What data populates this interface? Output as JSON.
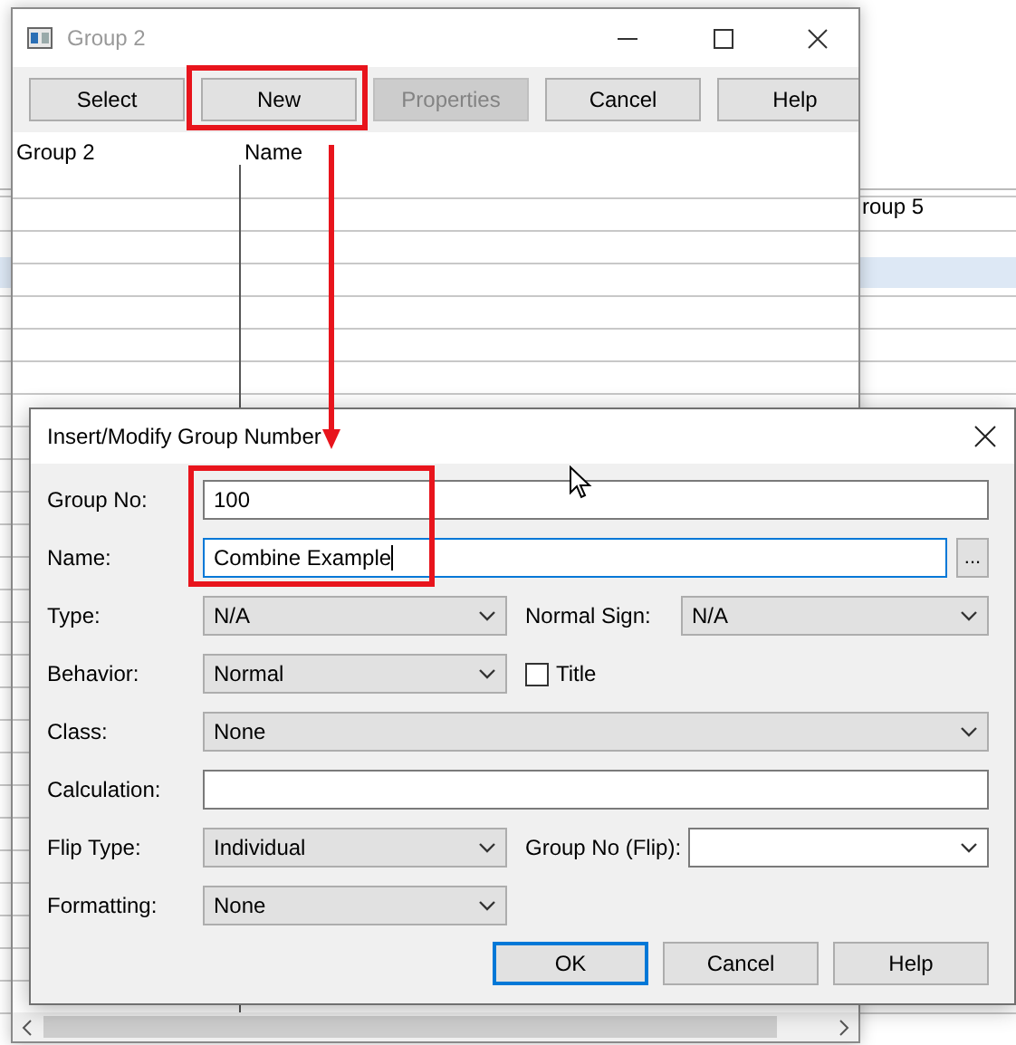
{
  "background": {
    "cell_text": "roup 5"
  },
  "window": {
    "title": "Group 2",
    "buttons": [
      {
        "label": "Select",
        "disabled": false
      },
      {
        "label": "New",
        "disabled": false
      },
      {
        "label": "Properties",
        "disabled": true
      },
      {
        "label": "Cancel",
        "disabled": false
      },
      {
        "label": "Help",
        "disabled": false
      }
    ],
    "table": {
      "columns": [
        "Group 2",
        "Name"
      ]
    }
  },
  "dialog": {
    "title": "Insert/Modify Group Number",
    "rows": [
      {
        "items": [
          {
            "kind": "label",
            "text": "Group No:"
          },
          {
            "kind": "text",
            "value": "100",
            "focused": false
          }
        ]
      },
      {
        "items": [
          {
            "kind": "label",
            "text": "Name:"
          },
          {
            "kind": "text",
            "value": "Combine Example",
            "focused": true
          },
          {
            "kind": "browse",
            "text": "..."
          }
        ]
      },
      {
        "items": [
          {
            "kind": "label",
            "text": "Type:"
          },
          {
            "kind": "combo",
            "value": "N/A"
          },
          {
            "kind": "label2",
            "text": "Normal Sign:"
          },
          {
            "kind": "combo-wide",
            "value": "N/A"
          }
        ]
      },
      {
        "items": [
          {
            "kind": "label",
            "text": "Behavior:"
          },
          {
            "kind": "combo",
            "value": "Normal"
          },
          {
            "kind": "checkbox",
            "text": "Title",
            "checked": false
          }
        ]
      },
      {
        "items": [
          {
            "kind": "label",
            "text": "Class:"
          },
          {
            "kind": "combo-wide",
            "value": "None"
          }
        ]
      },
      {
        "items": [
          {
            "kind": "label",
            "text": "Calculation:"
          },
          {
            "kind": "text",
            "focused": false
          }
        ]
      },
      {
        "items": [
          {
            "kind": "label",
            "text": "Flip Type:"
          },
          {
            "kind": "combo",
            "value": "Individual"
          },
          {
            "kind": "label2",
            "text": "Group No (Flip):"
          },
          {
            "kind": "combo-wide-white"
          }
        ]
      },
      {
        "items": [
          {
            "kind": "label",
            "text": "Formatting:"
          },
          {
            "kind": "combo",
            "value": "None"
          }
        ]
      }
    ],
    "buttons": [
      {
        "label": "OK",
        "default": true
      },
      {
        "label": "Cancel",
        "default": false
      },
      {
        "label": "Help",
        "default": false
      }
    ]
  }
}
